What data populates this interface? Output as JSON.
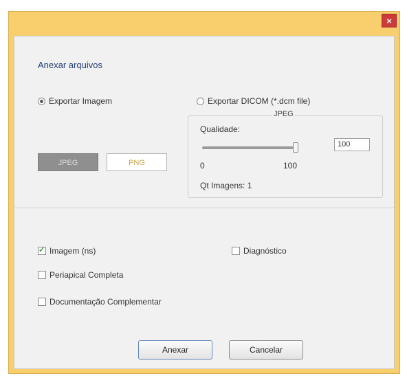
{
  "window": {
    "close_label": "×"
  },
  "section": {
    "title": "Anexar arquivos"
  },
  "export": {
    "option_image": {
      "label": "Exportar Imagem",
      "checked": true
    },
    "option_dicom": {
      "label": "Exportar DICOM (*.dcm file)",
      "checked": false
    },
    "group_title": "JPEG",
    "quality": {
      "label": "Qualidade:",
      "min_label": "0",
      "max_label": "100",
      "value": "100",
      "level": 100
    },
    "count_label": "Qt Imagens: 1",
    "format_buttons": {
      "jpeg": "JPEG",
      "png": "PNG"
    }
  },
  "attachments": {
    "imagem": {
      "label": "Imagem (ns)",
      "checked": true
    },
    "diagnostico": {
      "label": "Diagnóstico",
      "checked": false
    },
    "periapical": {
      "label": "Periapical Completa",
      "checked": false
    },
    "documentacao": {
      "label": "Documentação Complementar",
      "checked": false
    }
  },
  "actions": {
    "attach": "Anexar",
    "cancel": "Cancelar"
  },
  "colors": {
    "titlebar": "#f8cf6c",
    "close": "#cc3a3a",
    "title_text": "#243f7a"
  }
}
